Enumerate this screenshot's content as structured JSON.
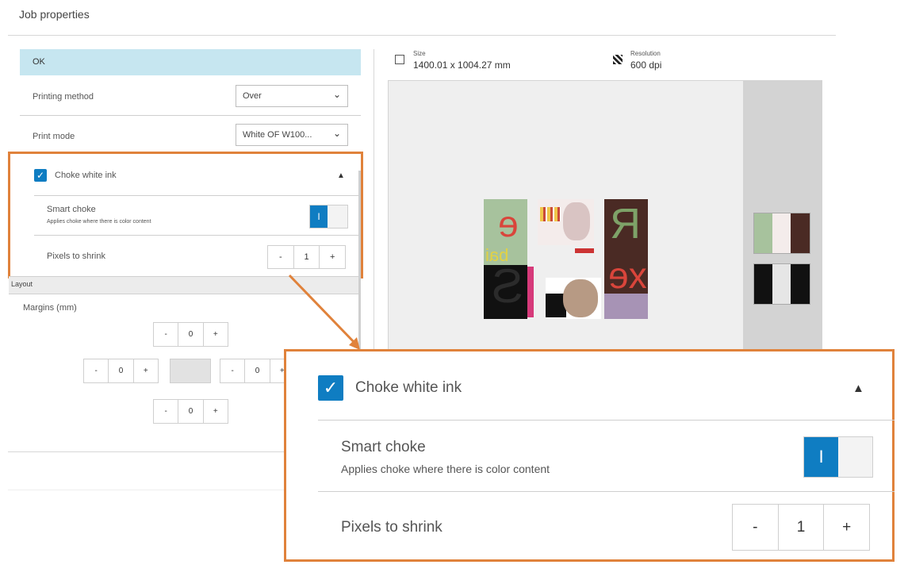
{
  "header": {
    "title": "Job properties"
  },
  "left_panel": {
    "status": "OK",
    "printing_method": {
      "label": "Printing method",
      "value": "Over"
    },
    "print_mode": {
      "label": "Print mode",
      "value": "White OF W100..."
    },
    "choke": {
      "label": "Choke white ink",
      "checked": true,
      "smart_choke": {
        "label": "Smart choke",
        "description": "Applies choke where there is color content",
        "toggle_text": "I"
      },
      "pixels_to_shrink": {
        "label": "Pixels to shrink",
        "value": "1",
        "minus": "-",
        "plus": "+"
      }
    },
    "layout": {
      "section_label": "Layout",
      "margins_label": "Margins (mm)",
      "top": "0",
      "left": "0",
      "right": "0",
      "bottom": "0",
      "minus": "-",
      "plus": "+"
    }
  },
  "preview": {
    "size_label": "Size",
    "size_value": "1400.01 x 1004.27 mm",
    "resolution_label": "Resolution",
    "resolution_value": "600 dpi",
    "tile_text": {
      "e": "e",
      "bai": "bai",
      "ya": "Я",
      "s": "S",
      "xe": "xe"
    }
  },
  "zoom_callout": {
    "choke_label": "Choke white ink",
    "smart_choke_label": "Smart choke",
    "smart_choke_description": "Applies choke where there is color content",
    "toggle_text": "I",
    "pixels_label": "Pixels to shrink",
    "pixels_value": "1",
    "minus": "-",
    "plus": "+"
  },
  "colors": {
    "accent": "#0f7dc2",
    "highlight": "#e0823b",
    "status_bg": "#c6e6f0"
  }
}
